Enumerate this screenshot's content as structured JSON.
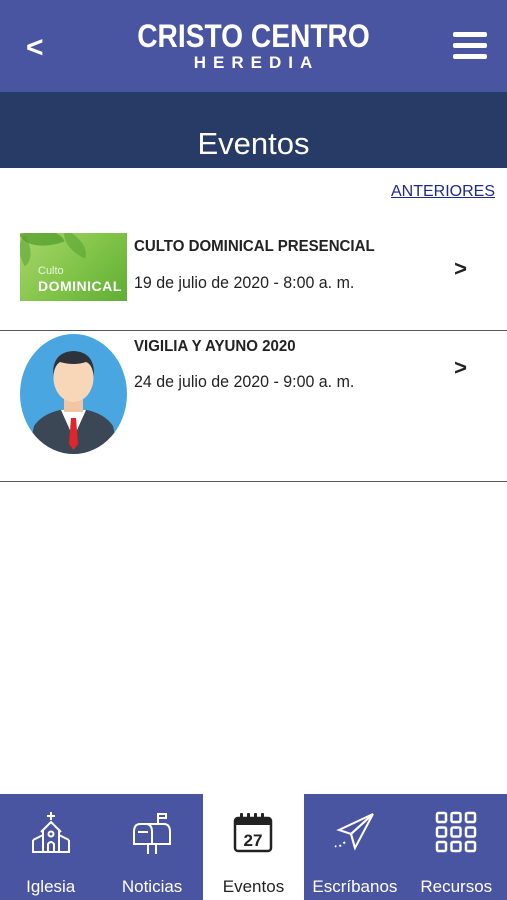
{
  "header": {
    "back_label": "<",
    "logo_main": "CRISTO CENTRO",
    "logo_sub": "HEREDIA"
  },
  "page": {
    "title": "Eventos"
  },
  "link_previous": "ANTERIORES",
  "events": [
    {
      "title": "CULTO DOMINICAL PRESENCIAL",
      "date": "19 de julio de 2020 - 8:00 a. m.",
      "thumb_line1": "Culto",
      "thumb_line2": "DOMINICAL",
      "chevron": ">"
    },
    {
      "title": "VIGILIA Y AYUNO 2020",
      "date": "24 de julio de 2020 - 9:00 a. m.",
      "chevron": ">"
    }
  ],
  "tabs": [
    {
      "label": "Iglesia",
      "icon": "church-icon",
      "active": false
    },
    {
      "label": "Noticias",
      "icon": "mailbox-icon",
      "active": false
    },
    {
      "label": "Eventos",
      "icon": "calendar-icon",
      "icon_text": "27",
      "active": true
    },
    {
      "label": "Escríbanos",
      "icon": "paper-plane-icon",
      "active": false
    },
    {
      "label": "Recursos",
      "icon": "grid-icon",
      "active": false
    }
  ],
  "colors": {
    "header_bg": "#4a55a2",
    "titlebar_bg": "#283a66",
    "link": "#1e2a8a",
    "tabbar_bg": "#4a55a2"
  }
}
